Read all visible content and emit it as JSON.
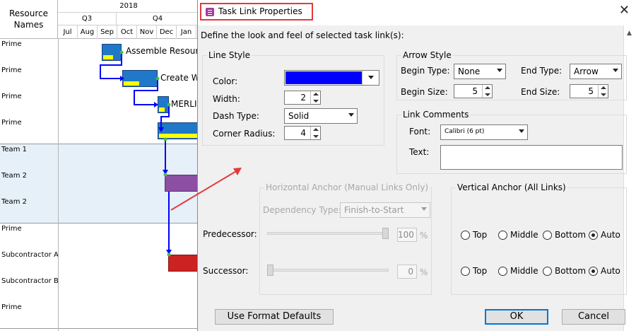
{
  "colors": {
    "link_color": "#0000ff",
    "bar_blue": "#1f78c8",
    "bar_purple": "#8c4fa3",
    "bar_red": "#cc2222",
    "progress": "#ffff00",
    "annotation_red": "#e23a3a"
  },
  "gantt": {
    "header": {
      "column_title": "Resource\nNames",
      "year": "2018",
      "quarters": [
        "Q3",
        "Q4"
      ],
      "months": [
        "Jul",
        "Aug",
        "Sep",
        "Oct",
        "Nov",
        "Dec",
        "Jan"
      ]
    },
    "rows": [
      {
        "name": "Prime"
      },
      {
        "name": "Prime"
      },
      {
        "name": "Prime"
      },
      {
        "name": "Prime"
      },
      {
        "name": "Team 1"
      },
      {
        "name": "Team 2"
      },
      {
        "name": "Team 2"
      },
      {
        "name": "Prime"
      },
      {
        "name": "Subcontractor A"
      },
      {
        "name": "Subcontractor B"
      },
      {
        "name": "Prime"
      }
    ],
    "bar_labels": [
      "Assemble Resource",
      "Create W",
      "MERLI"
    ]
  },
  "dialog": {
    "title": "Task Link Properties",
    "close_icon": "close-icon",
    "description": "Define the look and feel of selected task link(s):",
    "line_style": {
      "title": "Line Style",
      "color_label": "Color:",
      "width_label": "Width:",
      "width_value": "2",
      "dash_type_label": "Dash Type:",
      "dash_type_value": "Solid",
      "corner_radius_label": "Corner Radius:",
      "corner_radius_value": "4"
    },
    "arrow_style": {
      "title": "Arrow Style",
      "begin_type_label": "Begin Type:",
      "begin_type_value": "None",
      "end_type_label": "End Type:",
      "end_type_value": "Arrow",
      "begin_size_label": "Begin Size:",
      "begin_size_value": "5",
      "end_size_label": "End Size:",
      "end_size_value": "5"
    },
    "link_comments": {
      "title": "Link Comments",
      "font_label": "Font:",
      "font_value": "Calibri (6 pt)",
      "text_label": "Text:",
      "text_value": ""
    },
    "horizontal_anchor": {
      "title": "Horizontal Anchor (Manual Links Only)",
      "dependency_type_label": "Dependency Type:",
      "dependency_type_value": "Finish-to-Start",
      "predecessor_label": "Predecessor:",
      "predecessor_value": "100",
      "predecessor_level": 1.0,
      "successor_label": "Successor:",
      "successor_value": "0",
      "successor_level": 0.0,
      "percent_sign": "%"
    },
    "vertical_anchor": {
      "title": "Vertical Anchor (All Links)",
      "predecessor_options": [
        {
          "label": "Top",
          "selected": false
        },
        {
          "label": "Middle",
          "selected": false
        },
        {
          "label": "Bottom",
          "selected": false
        },
        {
          "label": "Auto",
          "selected": true
        }
      ],
      "successor_options": [
        {
          "label": "Top",
          "selected": false
        },
        {
          "label": "Middle",
          "selected": false
        },
        {
          "label": "Bottom",
          "selected": false
        },
        {
          "label": "Auto",
          "selected": true
        }
      ]
    },
    "buttons": {
      "use_format_defaults": "Use Format Defaults",
      "ok": "OK",
      "cancel": "Cancel"
    }
  }
}
